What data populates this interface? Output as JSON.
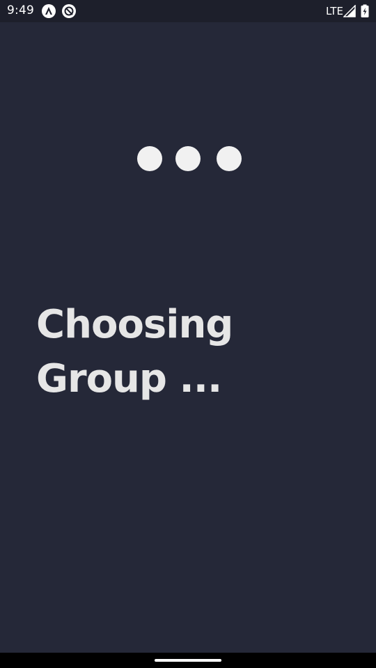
{
  "status_bar": {
    "time": "9:49",
    "network": "LTE",
    "icons": [
      "app-notification-icon",
      "sync-notification-icon",
      "signal-icon",
      "battery-icon"
    ]
  },
  "loading": {
    "indicator": "three-dots",
    "dot_color": "#f1f1f1"
  },
  "main": {
    "heading": "Choosing Group ..."
  },
  "colors": {
    "background": "#252838",
    "status_bar": "#1d1f2b",
    "heading_text": "#e6e6e6"
  }
}
